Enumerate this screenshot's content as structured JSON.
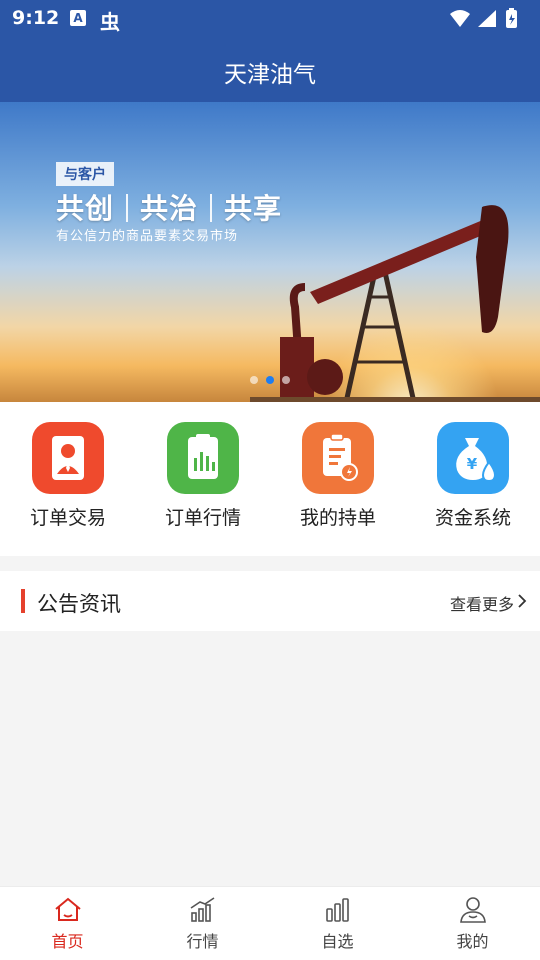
{
  "status_bar": {
    "time": "9:12",
    "notification_icons": [
      "translate-a-icon",
      "bug-icon"
    ],
    "system_icons": [
      "wifi-icon",
      "signal-icon",
      "battery-icon"
    ]
  },
  "header": {
    "title": "天津油气"
  },
  "banner": {
    "tag": "与客户",
    "slogan": [
      "共创",
      "共治",
      "共享"
    ],
    "subtitle": "有公信力的商品要素交易市场",
    "dots": 3,
    "active_dot": 1
  },
  "menu": {
    "items": [
      {
        "label": "订单交易",
        "icon": "user-icon",
        "color": "#ef4a2d"
      },
      {
        "label": "订单行情",
        "icon": "bar-chart-icon",
        "color": "#4fb548"
      },
      {
        "label": "我的持单",
        "icon": "clipboard-icon",
        "color": "#f0763a"
      },
      {
        "label": "资金系统",
        "icon": "money-bag-icon",
        "color": "#34a3f2"
      }
    ]
  },
  "notice": {
    "title": "公告资讯",
    "more_label": "查看更多"
  },
  "tabbar": {
    "items": [
      {
        "label": "首页",
        "icon": "home-icon",
        "active": true
      },
      {
        "label": "行情",
        "icon": "trend-chart-icon",
        "active": false
      },
      {
        "label": "自选",
        "icon": "favorites-bars-icon",
        "active": false
      },
      {
        "label": "我的",
        "icon": "profile-icon",
        "active": false
      }
    ],
    "active_color": "#d9281e",
    "inactive_color": "#555555"
  },
  "colors": {
    "primary": "#2b56a6",
    "accent": "#e5412d"
  }
}
